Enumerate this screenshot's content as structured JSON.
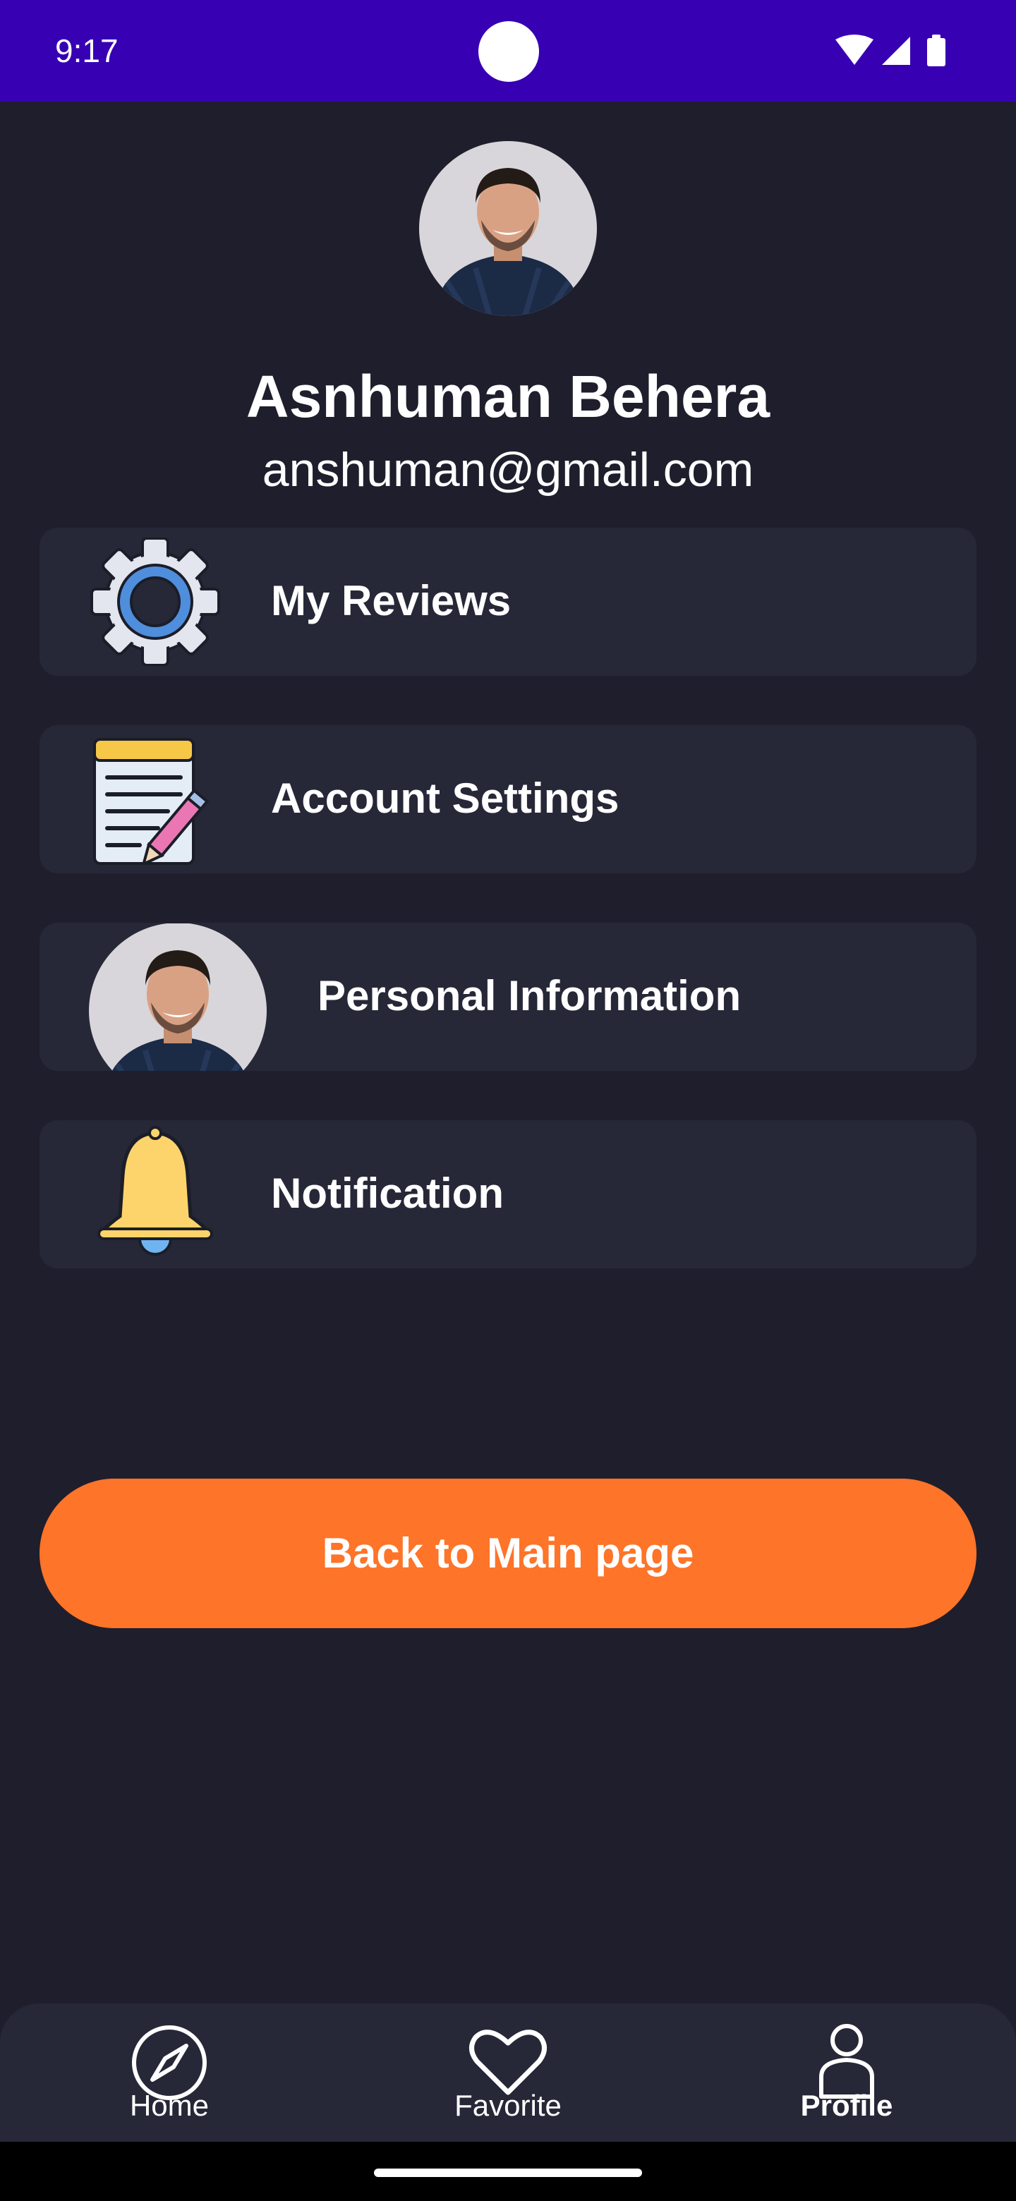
{
  "status_bar": {
    "time": "9:17",
    "icons": [
      "wifi-icon",
      "signal-icon",
      "battery-icon"
    ]
  },
  "profile": {
    "name": "Asnhuman Behera",
    "email": "anshuman@gmail.com",
    "avatar": "profile-photo"
  },
  "menu": [
    {
      "label": "My Reviews",
      "icon": "gear-icon"
    },
    {
      "label": "Account Settings",
      "icon": "notepad-pencil-icon"
    },
    {
      "label": "Personal Information",
      "icon": "profile-photo"
    },
    {
      "label": "Notification",
      "icon": "bell-icon"
    }
  ],
  "back_button": {
    "label": "Back to Main page"
  },
  "bottom_nav": {
    "items": [
      {
        "label": "Home",
        "icon": "compass-icon",
        "active": false
      },
      {
        "label": "Favorite",
        "icon": "heart-icon",
        "active": false
      },
      {
        "label": "Profile",
        "icon": "person-icon",
        "active": true
      }
    ]
  },
  "colors": {
    "status_bar": "#3700b3",
    "background": "#1f1e2c",
    "card": "#262838",
    "accent": "#fe7428",
    "text": "#ffffff"
  }
}
